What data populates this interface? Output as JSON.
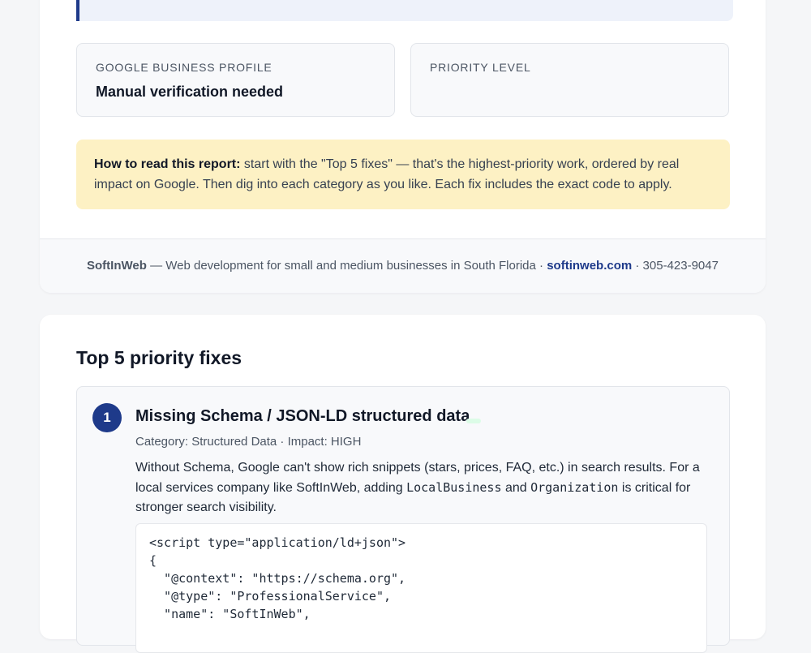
{
  "meta": {
    "gbp_label": "GOOGLE BUSINESS PROFILE",
    "gbp_value": "Manual verification needed",
    "priority_label": "PRIORITY LEVEL",
    "priority_value": ""
  },
  "howto": {
    "lead": "How to read this report:",
    "text": " start with the \"Top 5 fixes\" — that's the highest-priority work, ordered by real impact on Google. Then dig into each category as you like. Each fix includes the exact code to apply."
  },
  "footer": {
    "brand": "SoftInWeb",
    "tagline": " — Web development for small and medium businesses in South Florida · ",
    "website": "softinweb.com",
    "phone": " · 305-423-9047"
  },
  "top_fixes": {
    "title": "Top 5 priority fixes",
    "items": [
      {
        "number": "1",
        "title": "Missing Schema / JSON-LD structured data",
        "meta": "Category: Structured Data · Impact: HIGH",
        "desc_1": "Without Schema, Google can't show rich snippets (stars, prices, FAQ, etc.) in search results. For a local services company like SoftInWeb, adding ",
        "code_1": "LocalBusiness",
        "desc_2": " and ",
        "code_2": "Organization",
        "desc_3": " is critical for stronger search visibility.",
        "code": "<script type=\"application/ld+json\">\n{\n  \"@context\": \"https://schema.org\",\n  \"@type\": \"ProfessionalService\",\n  \"name\": \"SoftInWeb\","
      }
    ]
  }
}
